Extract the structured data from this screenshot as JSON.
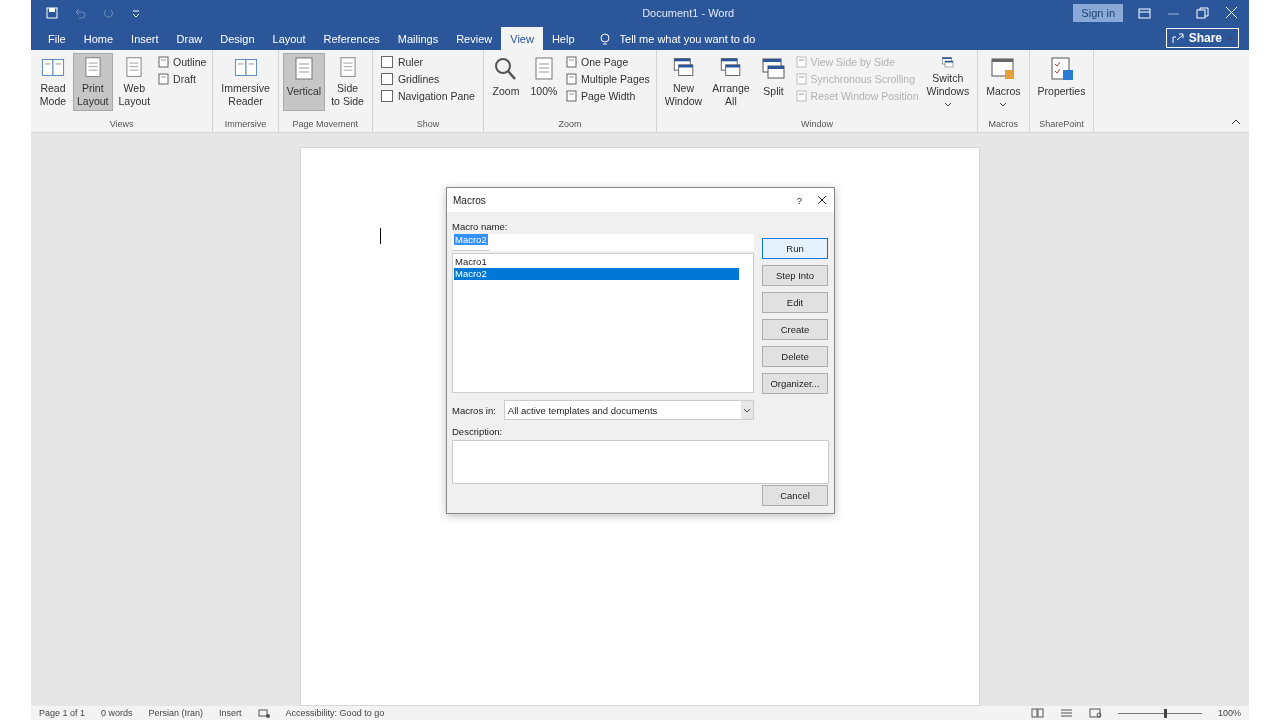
{
  "titlebar": {
    "title": "Document1  -  Word",
    "sign_in": "Sign in"
  },
  "tabs": [
    {
      "label": "File",
      "selected": false
    },
    {
      "label": "Home",
      "selected": false
    },
    {
      "label": "Insert",
      "selected": false
    },
    {
      "label": "Draw",
      "selected": false
    },
    {
      "label": "Design",
      "selected": false
    },
    {
      "label": "Layout",
      "selected": false
    },
    {
      "label": "References",
      "selected": false
    },
    {
      "label": "Mailings",
      "selected": false
    },
    {
      "label": "Review",
      "selected": false
    },
    {
      "label": "View",
      "selected": true
    },
    {
      "label": "Help",
      "selected": false
    }
  ],
  "tell_me": {
    "placeholder": "Tell me what you want to do"
  },
  "share": {
    "label": "Share"
  },
  "ribbon": {
    "groups": [
      {
        "label": "Views",
        "items": [
          {
            "kind": "large",
            "lines": [
              "Read",
              "Mode"
            ],
            "selected": false
          },
          {
            "kind": "large",
            "lines": [
              "Print",
              "Layout"
            ],
            "selected": true
          },
          {
            "kind": "large",
            "lines": [
              "Web",
              "Layout"
            ],
            "selected": false
          },
          {
            "kind": "stack",
            "items": [
              {
                "kind": "small",
                "label": "Outline",
                "disabled": false
              },
              {
                "kind": "small",
                "label": "Draft",
                "disabled": false
              }
            ]
          }
        ]
      },
      {
        "label": "Immersive",
        "items": [
          {
            "kind": "large",
            "lines": [
              "Immersive",
              "Reader"
            ],
            "selected": false
          }
        ]
      },
      {
        "label": "Page Movement",
        "items": [
          {
            "kind": "large",
            "lines": [
              "Vertical"
            ],
            "selected": true
          },
          {
            "kind": "large",
            "lines": [
              "Side",
              "to Side"
            ],
            "selected": false
          }
        ]
      },
      {
        "label": "Show",
        "items": [
          {
            "kind": "stack",
            "items": [
              {
                "kind": "check",
                "label": "Ruler",
                "checked": false
              },
              {
                "kind": "check",
                "label": "Gridlines",
                "checked": false
              },
              {
                "kind": "check",
                "label": "Navigation Pane",
                "checked": false
              }
            ]
          }
        ]
      },
      {
        "label": "Zoom",
        "items": [
          {
            "kind": "large",
            "lines": [
              "Zoom"
            ],
            "selected": false
          },
          {
            "kind": "large",
            "lines": [
              "100%"
            ],
            "selected": false
          },
          {
            "kind": "stack",
            "items": [
              {
                "kind": "small",
                "label": "One Page",
                "disabled": false
              },
              {
                "kind": "small",
                "label": "Multiple Pages",
                "disabled": false
              },
              {
                "kind": "small",
                "label": "Page Width",
                "disabled": false
              }
            ]
          }
        ]
      },
      {
        "label": "Window",
        "items": [
          {
            "kind": "large",
            "lines": [
              "New",
              "Window"
            ],
            "selected": false
          },
          {
            "kind": "large",
            "lines": [
              "Arrange",
              "All"
            ],
            "selected": false
          },
          {
            "kind": "large",
            "lines": [
              "Split"
            ],
            "selected": false
          },
          {
            "kind": "stack",
            "items": [
              {
                "kind": "small",
                "label": "View Side by Side",
                "disabled": true
              },
              {
                "kind": "small",
                "label": "Synchronous Scrolling",
                "disabled": true
              },
              {
                "kind": "small",
                "label": "Reset Window Position",
                "disabled": true
              }
            ]
          },
          {
            "kind": "large",
            "lines": [
              "Switch",
              "Windows"
            ],
            "selected": false,
            "dropdown": true
          }
        ]
      },
      {
        "label": "Macros",
        "items": [
          {
            "kind": "large",
            "lines": [
              "Macros"
            ],
            "selected": false,
            "dropdown": true
          }
        ]
      },
      {
        "label": "SharePoint",
        "items": [
          {
            "kind": "large",
            "lines": [
              "Properties"
            ],
            "selected": false
          }
        ]
      }
    ]
  },
  "dialog": {
    "title": "Macros",
    "help": "?",
    "name_label": "Macro name:",
    "name_value": "Macro2",
    "macros": [
      {
        "label": "Macro1",
        "selected": false
      },
      {
        "label": "Macro2",
        "selected": true
      }
    ],
    "buttons": [
      {
        "label": "Run",
        "default": true
      },
      {
        "label": "Step Into",
        "default": false
      },
      {
        "label": "Edit",
        "default": false
      },
      {
        "label": "Create",
        "default": false
      },
      {
        "label": "Delete",
        "default": false
      },
      {
        "label": "Organizer...",
        "default": false
      }
    ],
    "macros_in_label": "Macros in:",
    "macros_in_value": "All active templates and documents",
    "description_label": "Description:",
    "cancel": "Cancel"
  },
  "status_bar": {
    "left": [
      "Page 1 of 1",
      "0 words",
      "Persian (Iran)",
      "Insert"
    ],
    "accessibility": "Accessibility: Good to go",
    "zoom": {
      "level": 0.55,
      "reading": "100%"
    }
  }
}
